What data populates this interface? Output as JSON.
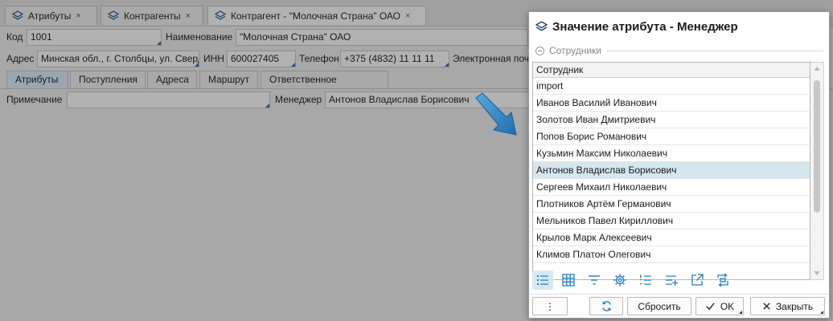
{
  "tabs": [
    {
      "label": "Атрибуты",
      "close": "×"
    },
    {
      "label": "Контрагенты",
      "close": "×"
    },
    {
      "label": "Контрагент - \"Молочная Страна\" ОАО",
      "close": "×"
    }
  ],
  "form": {
    "code_label": "Код",
    "code_value": "1001",
    "name_label": "Наименование",
    "name_value": "\"Молочная Страна\" ОАО",
    "address_label": "Адрес",
    "address_value": "Минская обл., г. Столбцы, ул. Сверд",
    "inn_label": "ИНН",
    "inn_value": "600027405",
    "phone_label": "Телефон",
    "phone_value": "+375 (4832) 11 11 11",
    "email_label": "Электронная поч",
    "note_label": "Примечание",
    "note_value": "",
    "manager_label": "Менеджер",
    "manager_value": "Антонов Владислав Борисович"
  },
  "subtabs": [
    "Атрибуты",
    "Поступления",
    "Адреса",
    "Маршрут",
    "Ответственное хранение"
  ],
  "dialog": {
    "title": "Значение атрибута - Менеджер",
    "group": "Сотрудники",
    "column": "Сотрудник",
    "rows": [
      "import",
      "Иванов Василий Иванович",
      "Золотов Иван Дмитриевич",
      "Попов Борис Романович",
      "Кузьмин Максим Николаевич",
      "Антонов Владислав Борисович",
      "Сергеев Михаил Николаевич",
      "Плотников Артём Германович",
      "Мельников Павел Кириллович",
      "Крылов Марк Алексеевич",
      "Климов Платон Олегович"
    ],
    "selected_row": "Антонов Владислав Борисович",
    "more_label": "⋮",
    "reset_label": "Сбросить",
    "ok_label": "OK",
    "close_label": "Закрыть"
  },
  "colors": {
    "accent": "#1f7fc4",
    "selected_row": "#d6e6ee",
    "overlay": "#a8a8a8"
  }
}
